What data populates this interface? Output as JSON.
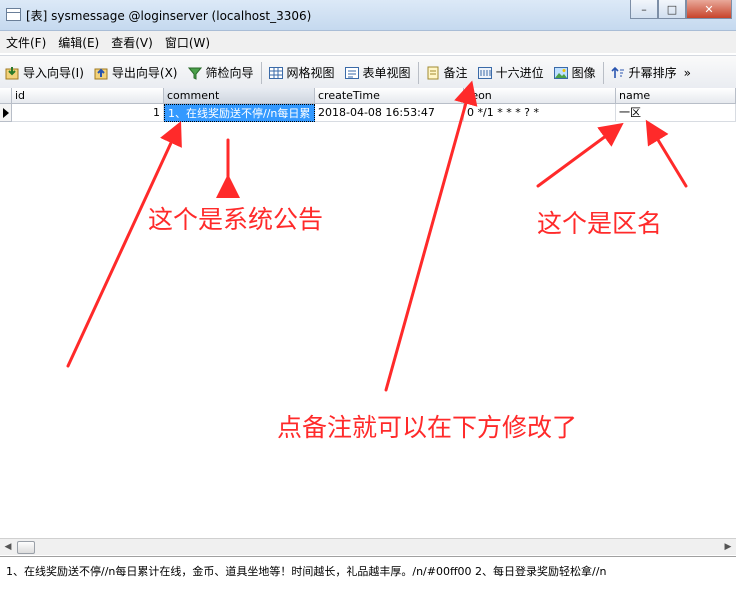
{
  "window": {
    "title": "[表] sysmessage @loginserver (localhost_3306)",
    "minimize_glyph": "–",
    "maximize_glyph": "□",
    "close_glyph": "✕"
  },
  "menu": [
    "文件(F)",
    "编辑(E)",
    "查看(V)",
    "窗口(W)"
  ],
  "toolbar": {
    "import": "导入向导(I)",
    "export": "导出向导(X)",
    "filter": "筛检向导",
    "grid_view": "网格视图",
    "form_view": "表单视图",
    "memo": "备注",
    "hex": "十六进位",
    "image": "图像",
    "sort": "升幂排序",
    "more": "»"
  },
  "columns": [
    "id",
    "comment",
    "createTime",
    "teon",
    "name"
  ],
  "rows": [
    {
      "id": "1",
      "comment": "1、在线奖励送不停//n每日累",
      "createTime": "2018-04-08 16:53:47",
      "teon": "0 */1 * * * ? *",
      "name": "一区"
    }
  ],
  "memo_text": "1、在线奖励送不停//n每日累计在线，金币、道具坐地等！时间越长，礼品越丰厚。/n/#00ff00 2、每日登录奖励轻松拿//n",
  "annotations": {
    "comment_note": "这个是系统公告",
    "name_note": "这个是区名",
    "memo_note": "点备注就可以在下方修改了"
  },
  "colors": {
    "annotation": "#ff2a2a",
    "selection": "#3399ff"
  }
}
